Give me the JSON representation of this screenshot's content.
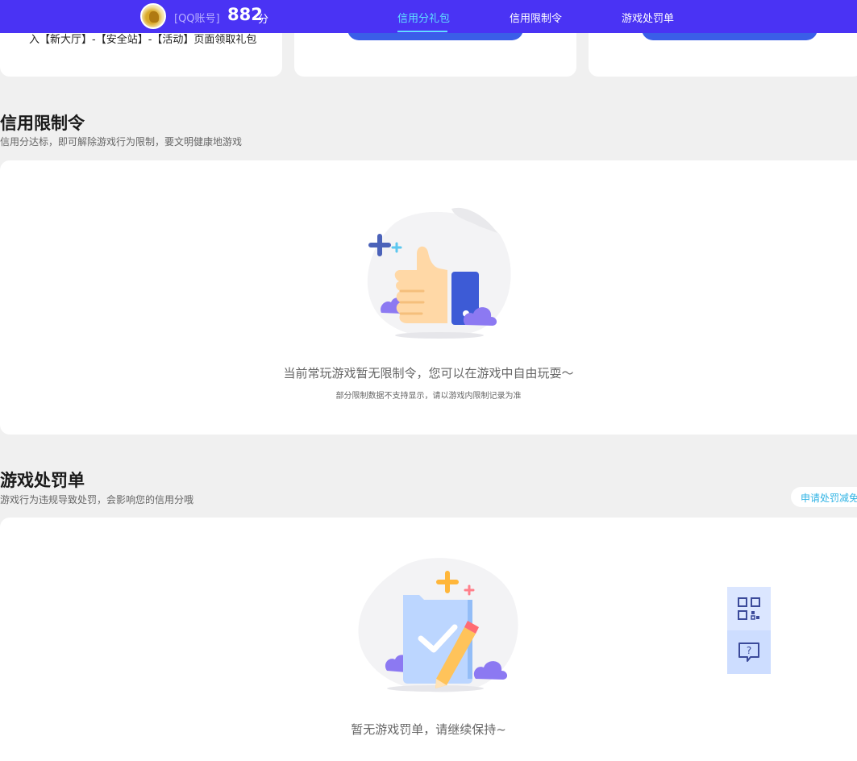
{
  "header": {
    "account_label": "[QQ账号]",
    "score": "882",
    "score_unit": "分",
    "tabs": [
      {
        "label": "信用分礼包",
        "active": true
      },
      {
        "label": "信用限制令",
        "active": false
      },
      {
        "label": "游戏处罚单",
        "active": false
      }
    ]
  },
  "gift_cards": {
    "first_card_text": "入【新大厅】-【安全站】-【活动】页面领取礼包"
  },
  "restriction": {
    "title": "信用限制令",
    "subtitle": "信用分达标，即可解除游戏行为限制，要文明健康地游戏",
    "empty_main": "当前常玩游戏暂无限制令，您可以在游戏中自由玩耍～",
    "empty_sub": "部分限制数据不支持显示，请以游戏内限制记录为准"
  },
  "penalty": {
    "title": "游戏处罚单",
    "subtitle": "游戏行为违规导致处罚，会影响您的信用分哦",
    "apply_button": "申请处罚减免",
    "empty_main": "暂无游戏罚单，请继续保持~"
  },
  "side_tools": {
    "icons": [
      "qr-code-icon",
      "help-chat-icon"
    ]
  },
  "colors": {
    "brand": "#4a33f4",
    "active_tab": "#5ee0ff",
    "button_blue": "#3a5ee8",
    "link_cyan": "#2fb3e4"
  }
}
